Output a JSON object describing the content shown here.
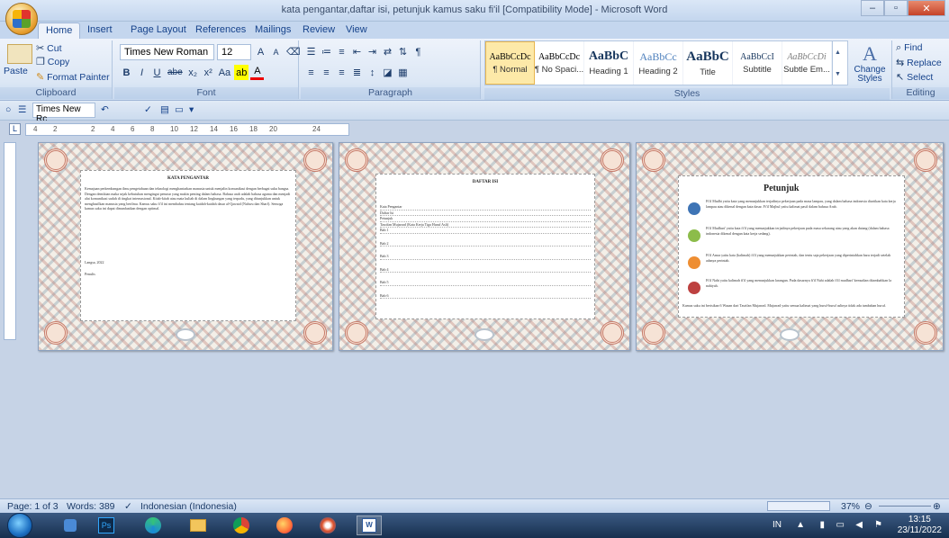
{
  "window": {
    "title": "kata pengantar,daftar isi, petunjuk kamus saku fi'il [Compatibility Mode] - Microsoft Word",
    "minimize": "–",
    "maximize": "▫",
    "close": "✕"
  },
  "tabs": [
    "Home",
    "Insert",
    "Page Layout",
    "References",
    "Mailings",
    "Review",
    "View"
  ],
  "clipboard": {
    "paste": "Paste",
    "cut": "Cut",
    "copy": "Copy",
    "format_painter": "Format Painter",
    "label": "Clipboard"
  },
  "font": {
    "name": "Times New Roman",
    "size": "12",
    "label": "Font",
    "bold": "B",
    "italic": "I",
    "underline": "U",
    "strike": "abe",
    "subscript": "x₂",
    "superscript": "x²",
    "change_case": "Aa",
    "grow": "A",
    "shrink": "A"
  },
  "paragraph": {
    "label": "Paragraph"
  },
  "styles": {
    "label": "Styles",
    "items": [
      {
        "preview": "AaBbCcDc",
        "name": "¶ Normal"
      },
      {
        "preview": "AaBbCcDc",
        "name": "¶ No Spaci..."
      },
      {
        "preview": "AaBbC",
        "name": "Heading 1"
      },
      {
        "preview": "AaBbCc",
        "name": "Heading 2"
      },
      {
        "preview": "AaBbC",
        "name": "Title"
      },
      {
        "preview": "AaBbCcI",
        "name": "Subtitle"
      },
      {
        "preview": "AaBbCcDi",
        "name": "Subtle Em..."
      }
    ],
    "change": "Change Styles"
  },
  "editing": {
    "label": "Editing",
    "find": "Find",
    "replace": "Replace",
    "select": "Select"
  },
  "qat": {
    "font": "Times New Rc"
  },
  "ruler_numbers": [
    "4",
    "2",
    "2",
    "4",
    "6",
    "8",
    "10",
    "12",
    "14",
    "16",
    "18",
    "20",
    "24"
  ],
  "pages": {
    "p1": {
      "heading": "KATA PENGANTAR",
      "body": "Kemajuan perkembangan ilmu pengetahuan dan teknologi menghantarkan manusia untuk menjalin komunikasi dengan berbagai suku bangsa. Dengan demikian maka sejak kebutuhan mengingat penutur yang makin penting dalam bahasa. Bahasa arab adalah bahasa agama dan menjadi alat komunikasi sudah di tingkat internasional. Kitab-kitab atau mata kuliah di dalam lingkungan yang terpadu, yang ditunjukkan untuk menghasilkan manusia yang berilmu. Kamus saku fi'il ini membahas tentang kaidah-kaidah dasar al-Qawaid (Nahwu dan Sharf). Semoga kamus saku ini dapat dimanfaatkan dengan optimal.",
      "place": "Langsa, 2022",
      "author": "Penulis"
    },
    "p2": {
      "heading": "DAFTAR ISI",
      "items": [
        "Kata Pengantar",
        "Daftar Isi",
        "Petunjuk",
        "Tasrifan Mujarrad (Kata Kerja Tiga Huruf Asli)",
        "Bab 1",
        "Bab 2",
        "Bab 3",
        "Bab 4",
        "Bab 5",
        "Bab 6"
      ]
    },
    "p3": {
      "heading": "Petunjuk",
      "entries": [
        {
          "color": "#3e74b5",
          "text": "Fi'il Madhi yaitu kata yang menunjukkan terjadinya pekerjaan pada masa lampau, yang dalam bahasa indonesia diartikan kata kerja lampau atau dikenal dengan kata dasar. Fi'il Majhul yaitu kalimat pasif dalam bahasa Arab."
        },
        {
          "color": "#8cbc4a",
          "text": "Fi'il Mudhari' yaitu kata fi'il yang menunjukkan terjadinya pekerjaan pada masa sekarang atau yang akan datang (dalam bahasa indonesia dikenal dengan kata kerja sedang)."
        },
        {
          "color": "#ee8e33",
          "text": "Fi'il Amar yaitu kata (kalimah) fi'il yang menunjukkan perintah, dan tentu saja pekerjaan yang diperintahkan baru terjadi setelah adanya perintah."
        },
        {
          "color": "#bd4140",
          "text": "Fi'il Nahi yaitu kalimah fi'il yang menunjukkan larangan. Pada dasarnya fi'il Nahi adalah fi'il mudhari' kemudian ditambahkan la nahiyah."
        }
      ],
      "footer": "Kamus saku ini berisikan 6 Wazan dari Tasrifan Mujarrad. Mujarrad yaitu semua kalimat yang huruf-huruf aslinya tidak ada tambahan huruf."
    }
  },
  "status": {
    "page": "Page: 1 of 3",
    "words": "Words: 389",
    "language": "Indonesian (Indonesia)",
    "zoom": "37%"
  },
  "taskbar": {
    "lang": "IN",
    "time": "13:15",
    "date": "23/11/2022"
  }
}
